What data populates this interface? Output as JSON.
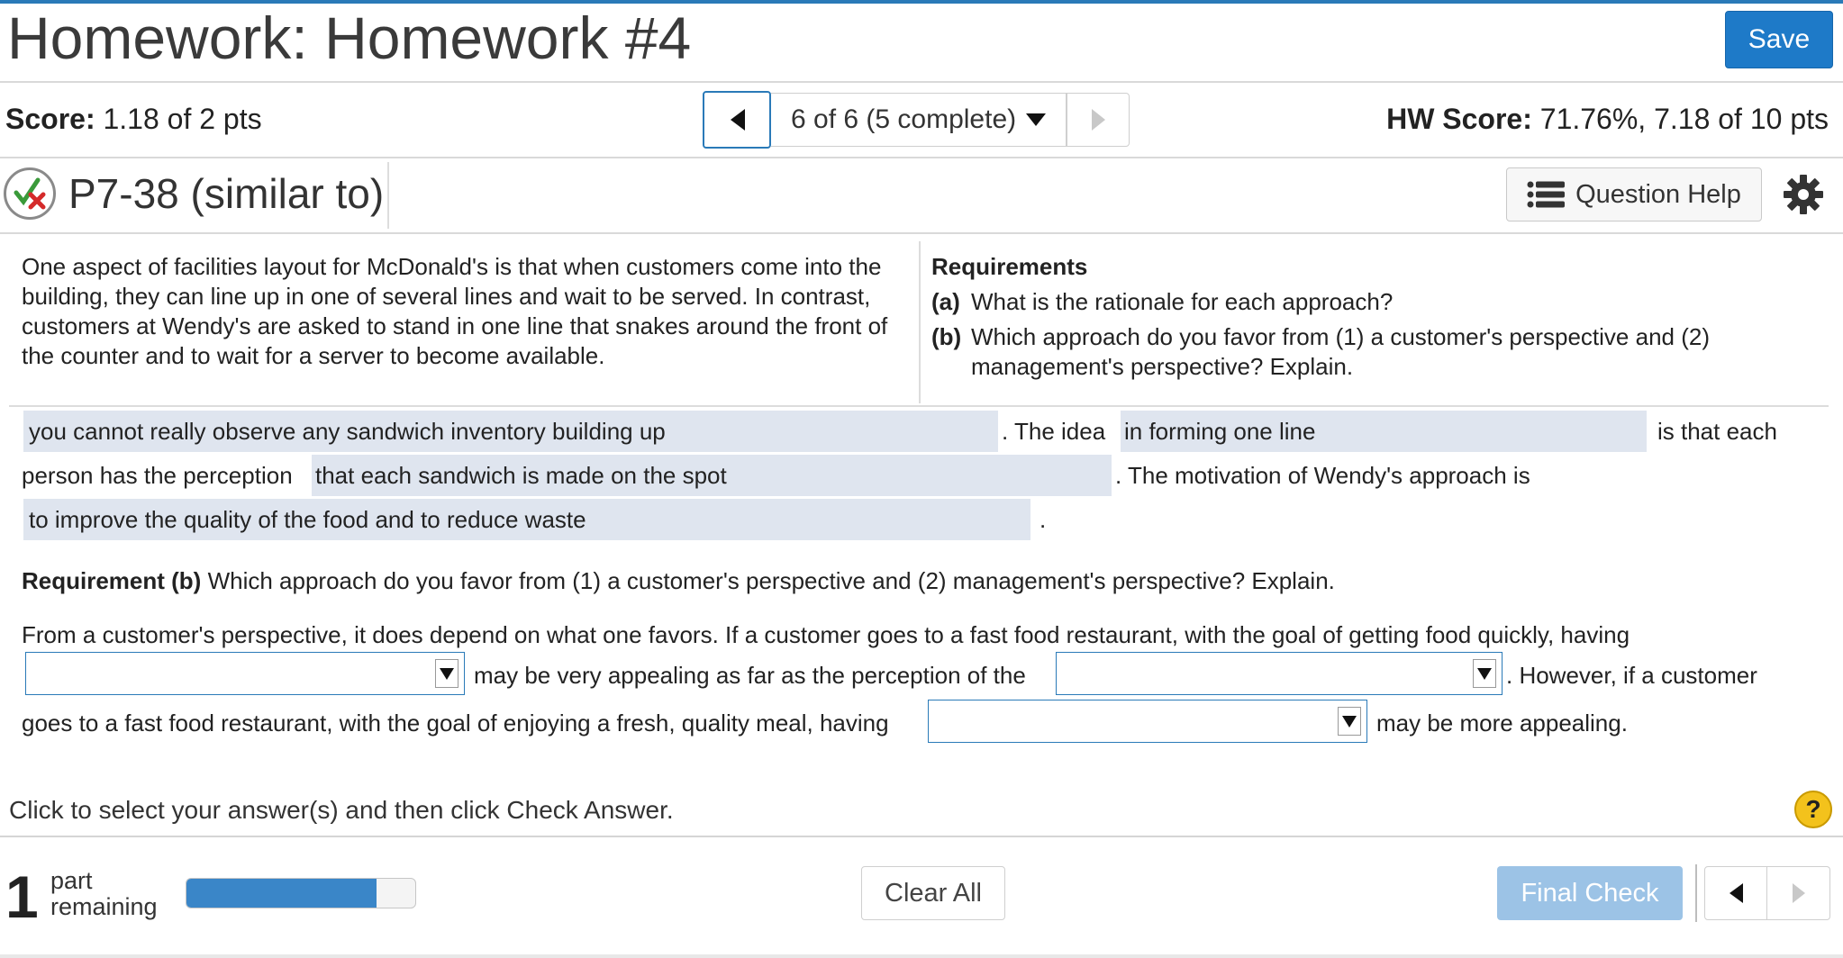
{
  "header": {
    "title": "Homework: Homework #4",
    "save_label": "Save"
  },
  "score_row": {
    "score_label": "Score:",
    "score_value": "1.18 of 2 pts",
    "nav_select_label": "6 of 6 (5 complete)",
    "hw_score_label": "HW Score:",
    "hw_score_value": "71.76%, 7.18 of 10 pts"
  },
  "question": {
    "id": "P7-38 (similar to)",
    "help_label": "Question Help",
    "status_icon": "partial-correct-icon",
    "problem_text": "One aspect of facilities layout for McDonald's is that when customers come into the building, they can line up in one of several lines and wait to be served. In contrast, customers at Wendy's are asked to stand in one line that snakes around the front of the counter and to wait for a server to become available.",
    "requirements_title": "Requirements",
    "requirements": [
      {
        "letter": "(a)",
        "text": "What is the rationale for each approach?"
      },
      {
        "letter": "(b)",
        "text": "Which approach do you favor from (1) a customer's perspective and (2) management's perspective? Explain."
      }
    ]
  },
  "answers_a": {
    "fill1": "you cannot really observe any sandwich inventory building up",
    "text1": ". The idea",
    "fill2": "in forming one line",
    "text2": "is that each",
    "text3": "person has the perception",
    "fill3": "that each sandwich is made on the spot",
    "text4": ". The motivation of Wendy's approach is",
    "fill4": "to improve the quality of the food and to reduce waste",
    "text5": "."
  },
  "requirement_b": {
    "label": "Requirement (b)",
    "text": "Which approach do you favor from (1) a customer's perspective and (2) management's perspective? Explain.",
    "line1": "From a customer's perspective, it does depend on what one favors. If a customer goes to a fast food restaurant, with the goal of getting food quickly, having",
    "text_after_dd1": "may be very appealing as far as the perception of the",
    "text_after_dd2": ". However, if a customer",
    "line3": "goes to a fast food restaurant, with the goal of enjoying a fresh, quality meal, having",
    "text_after_dd3": "may be more appealing.",
    "dropdown1_value": "",
    "dropdown2_value": "",
    "dropdown3_value": ""
  },
  "instructions": "Click to select your answer(s) and then click Check Answer.",
  "footer": {
    "parts_count": "1",
    "parts_label_line1": "part",
    "parts_label_line2": "remaining",
    "progress_fraction": 0.83,
    "clear_all_label": "Clear All",
    "final_check_label": "Final Check"
  },
  "colors": {
    "accent": "#1e7ac8",
    "fill_bg": "#dfe5ef",
    "final_check_disabled": "#9cc3e6",
    "help_mark": "#f3c21c"
  }
}
